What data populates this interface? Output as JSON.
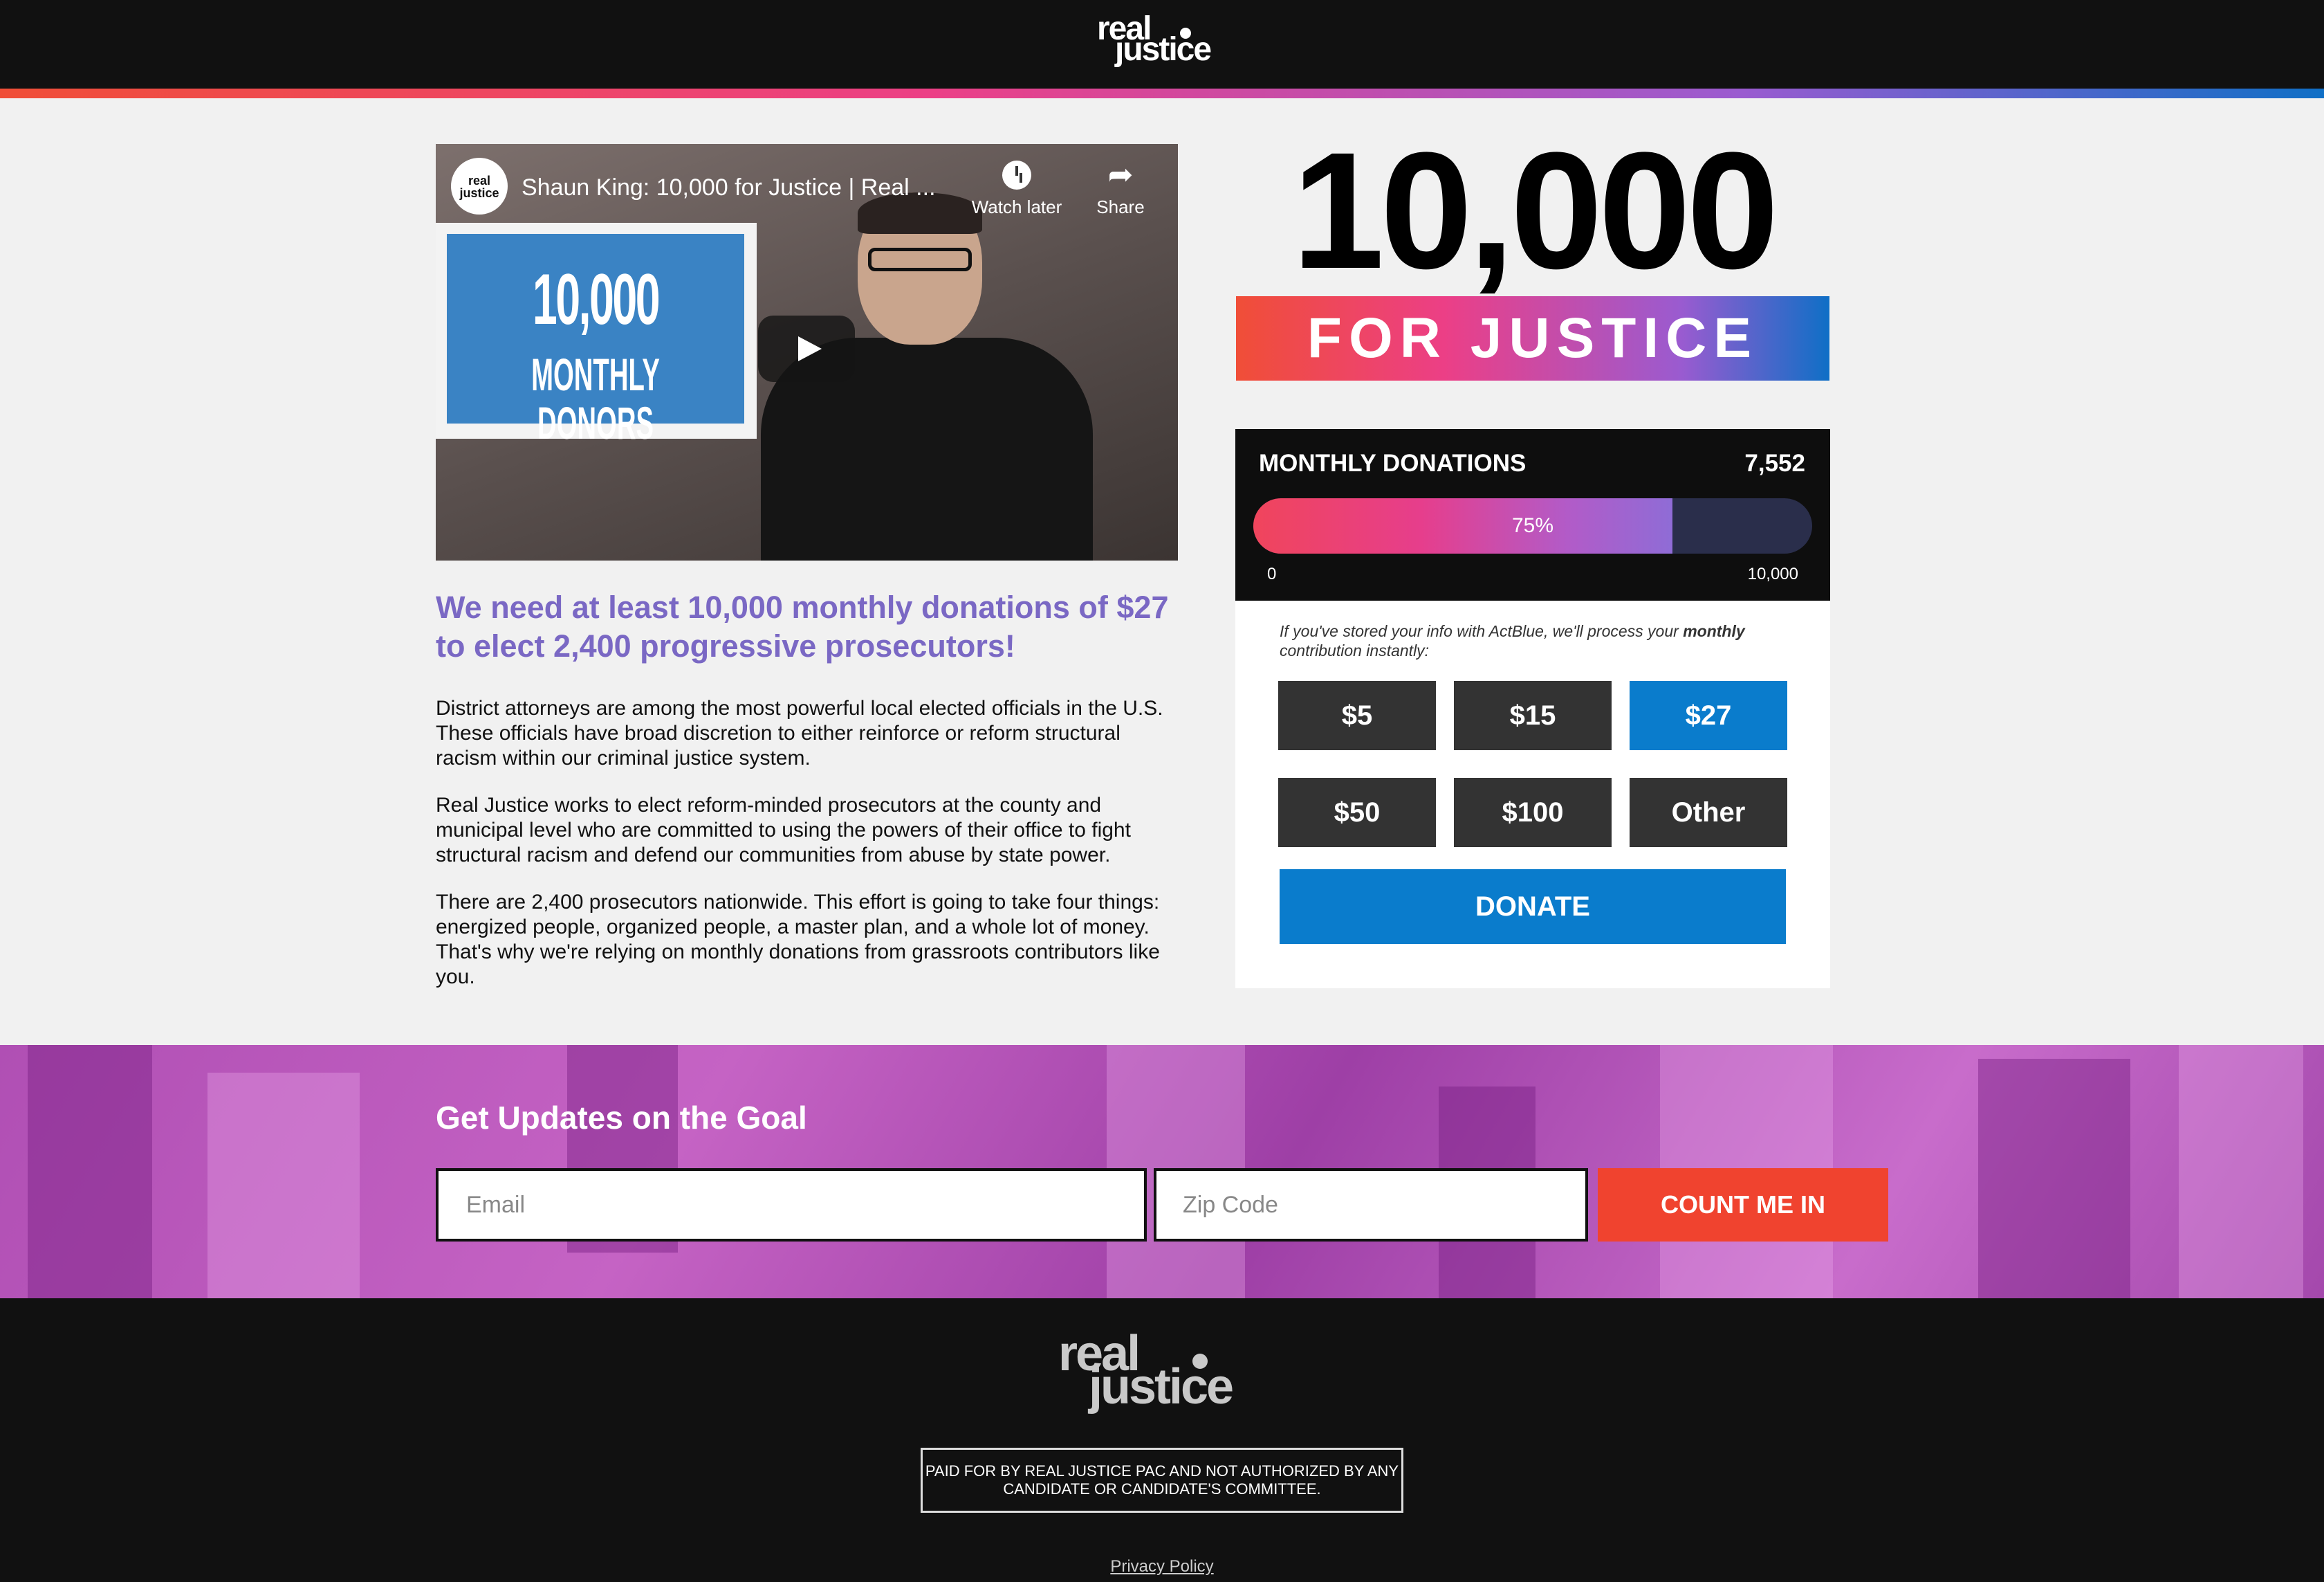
{
  "header": {
    "logo_line1": "real",
    "logo_line2": "justice"
  },
  "video": {
    "channel_logo_line1": "real",
    "channel_logo_line2": "justice",
    "title": "Shaun King: 10,000 for Justice | Real ...",
    "watch_later_label": "Watch later",
    "share_label": "Share",
    "card_number": "10,000",
    "card_label": "MONTHLY DONORS",
    "watermark": "real justice"
  },
  "content": {
    "headline": "We need at least 10,000 monthly donations of $27 to elect 2,400 progressive prosecutors!",
    "paragraphs": [
      "District attorneys are among the most powerful local elected officials in the U.S. These officials have broad discretion to either reinforce or reform structural racism within our criminal justice system.",
      "Real Justice works to elect reform-minded prosecutors at the county and municipal level who are committed to using the powers of their office to fight structural racism and defend our communities from abuse by state power.",
      "There are 2,400 prosecutors nationwide. This effort is going to take four things: energized people, organized people, a master plan, and a whole lot of money. That's why we're relying on monthly donations from grassroots contributors like you."
    ]
  },
  "campaign": {
    "big_number": "10,000",
    "banner": "FOR JUSTICE"
  },
  "donations": {
    "label": "MONTHLY DONATIONS",
    "count": "7,552",
    "progress_percent": 75,
    "progress_label": "75%",
    "min_label": "0",
    "max_label": "10,000",
    "note_pre": "If you've stored your info with ActBlue, we'll process your ",
    "note_bold": "monthly",
    "note_post": " contribution instantly:",
    "amounts": [
      "$5",
      "$15",
      "$27",
      "$50",
      "$100",
      "Other"
    ],
    "selected_amount": "$27",
    "donate_label": "DONATE",
    "colors": {
      "selected": "#0a7ccc",
      "unselected": "#333333"
    }
  },
  "updates": {
    "heading": "Get Updates on the Goal",
    "email_placeholder": "Email",
    "zip_placeholder": "Zip Code",
    "submit_label": "COUNT ME IN",
    "submit_color": "#f0432f"
  },
  "footer": {
    "logo_line1": "real",
    "logo_line2": "justice",
    "disclaimer": "PAID FOR BY REAL JUSTICE PAC AND NOT AUTHORIZED BY ANY CANDIDATE OR CANDIDATE'S COMMITTEE.",
    "privacy_label": "Privacy Policy"
  }
}
